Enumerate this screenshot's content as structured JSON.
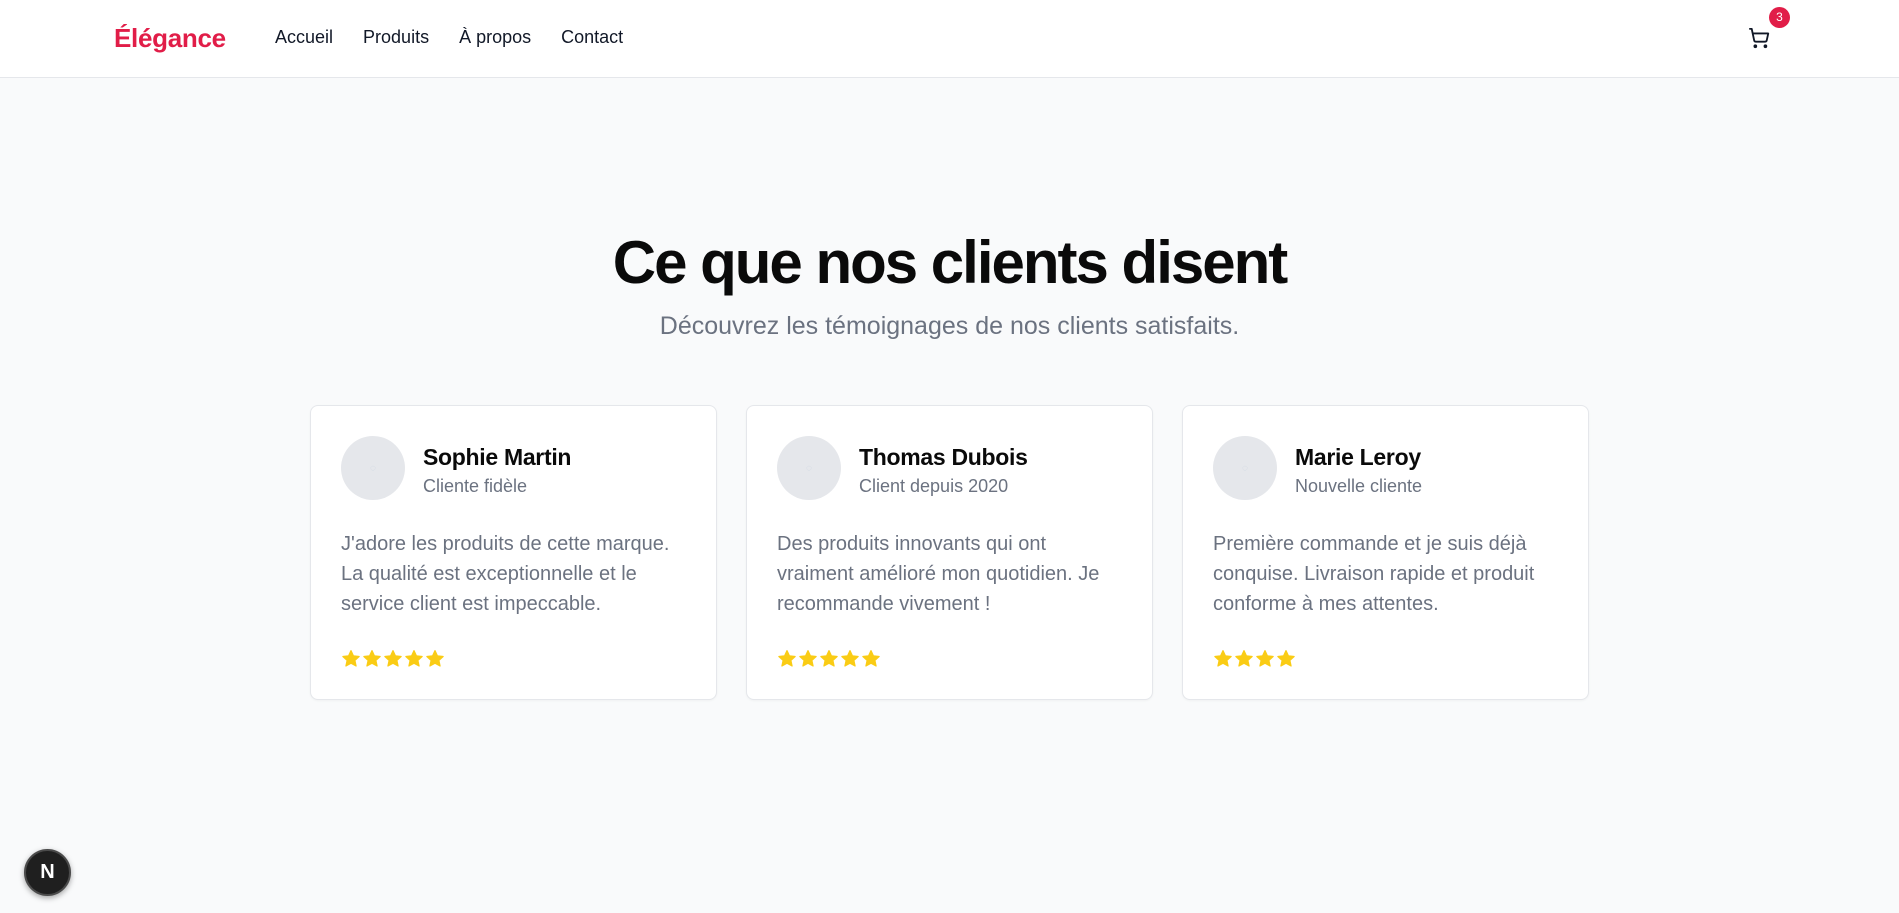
{
  "header": {
    "logo": "Élégance",
    "nav": [
      "Accueil",
      "Produits",
      "À propos",
      "Contact"
    ],
    "cart_count": "3"
  },
  "section": {
    "title": "Ce que nos clients disent",
    "subtitle": "Découvrez les témoignages de nos clients satisfaits."
  },
  "testimonials": [
    {
      "name": "Sophie Martin",
      "role": "Cliente fidèle",
      "text": "J'adore les produits de cette marque. La qualité est exceptionnelle et le service client est impeccable.",
      "rating": 5
    },
    {
      "name": "Thomas Dubois",
      "role": "Client depuis 2020",
      "text": "Des produits innovants qui ont vraiment amélioré mon quotidien. Je recommande vivement !",
      "rating": 5
    },
    {
      "name": "Marie Leroy",
      "role": "Nouvelle cliente",
      "text": "Première commande et je suis déjà conquise. Livraison rapide et produit conforme à mes attentes.",
      "rating": 4
    }
  ],
  "dev_badge": "N",
  "colors": {
    "accent": "#e11d48",
    "star": "#facc15",
    "muted": "#6b7280",
    "bg": "#f9fafb"
  }
}
